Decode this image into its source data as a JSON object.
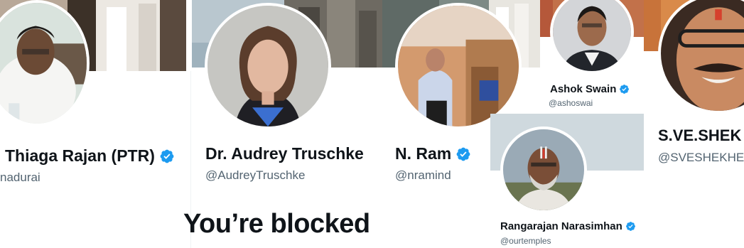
{
  "profiles": {
    "ptr": {
      "name": "Thiaga Rajan (PTR)",
      "handle": "nadurai",
      "verified": true
    },
    "audrey": {
      "name": "Dr. Audrey Truschke",
      "handle": "@AudreyTruschke",
      "verified": true
    },
    "ram": {
      "name": "N. Ram",
      "handle": "@nramind",
      "verified": true
    },
    "swain": {
      "name": "Ashok Swain",
      "handle": "@ashoswai",
      "verified": true
    },
    "shekher": {
      "name": "S.VE.SHEK",
      "handle": "@SVESHEKHE",
      "verified": false
    },
    "rangarajan": {
      "name": "Rangarajan Narasimhan",
      "handle": "@ourtemples",
      "verified": true
    }
  },
  "message": {
    "blocked": "You’re blocked"
  },
  "colors": {
    "verified": "#1d9bf0",
    "text": "#0f1419",
    "muted": "#536471",
    "divider": "#eff3f4"
  }
}
